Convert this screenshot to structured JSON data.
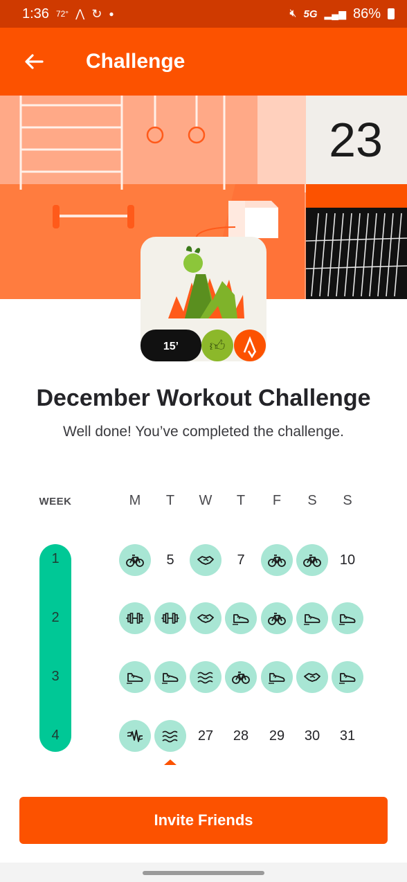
{
  "status": {
    "time": "1:36",
    "temp": "72°",
    "network": "5G",
    "battery": "86%"
  },
  "appbar": {
    "title": "Challenge"
  },
  "hero": {
    "counter": "23"
  },
  "badge": {
    "duration": "15’"
  },
  "challenge": {
    "title": "December Workout Challenge",
    "subtitle": "Well done! You’ve completed the challenge."
  },
  "calendar": {
    "week_label": "WEEK",
    "days": [
      "M",
      "T",
      "W",
      "T",
      "F",
      "S",
      "S"
    ],
    "weeks": [
      {
        "label": "1",
        "cells": [
          {
            "type": "icon",
            "icon": "bike-icon"
          },
          {
            "type": "num",
            "text": "5"
          },
          {
            "type": "icon",
            "icon": "handshake-icon"
          },
          {
            "type": "num",
            "text": "7"
          },
          {
            "type": "icon",
            "icon": "bike-icon"
          },
          {
            "type": "icon",
            "icon": "bike-icon"
          },
          {
            "type": "num",
            "text": "10"
          }
        ]
      },
      {
        "label": "2",
        "cells": [
          {
            "type": "icon",
            "icon": "dumbbell-icon"
          },
          {
            "type": "icon",
            "icon": "dumbbell-icon"
          },
          {
            "type": "icon",
            "icon": "handshake-icon"
          },
          {
            "type": "icon",
            "icon": "shoe-icon"
          },
          {
            "type": "icon",
            "icon": "bike-icon"
          },
          {
            "type": "icon",
            "icon": "shoe-icon"
          },
          {
            "type": "icon",
            "icon": "shoe-icon"
          }
        ]
      },
      {
        "label": "3",
        "cells": [
          {
            "type": "icon",
            "icon": "shoe-icon"
          },
          {
            "type": "icon",
            "icon": "shoe-icon"
          },
          {
            "type": "icon",
            "icon": "swim-icon"
          },
          {
            "type": "icon",
            "icon": "bike-icon"
          },
          {
            "type": "icon",
            "icon": "shoe-icon"
          },
          {
            "type": "icon",
            "icon": "handshake-icon"
          },
          {
            "type": "icon",
            "icon": "shoe-icon"
          }
        ]
      },
      {
        "label": "4",
        "cells": [
          {
            "type": "icon",
            "icon": "wind-icon"
          },
          {
            "type": "icon",
            "icon": "swim-icon"
          },
          {
            "type": "num",
            "text": "27"
          },
          {
            "type": "num",
            "text": "28"
          },
          {
            "type": "num",
            "text": "29"
          },
          {
            "type": "num",
            "text": "30"
          },
          {
            "type": "num",
            "text": "31"
          }
        ]
      }
    ]
  },
  "invite": {
    "label": "Invite Friends"
  },
  "colors": {
    "brand": "#fc5200",
    "active": "#00c896",
    "active_light": "#a8e6d4"
  }
}
